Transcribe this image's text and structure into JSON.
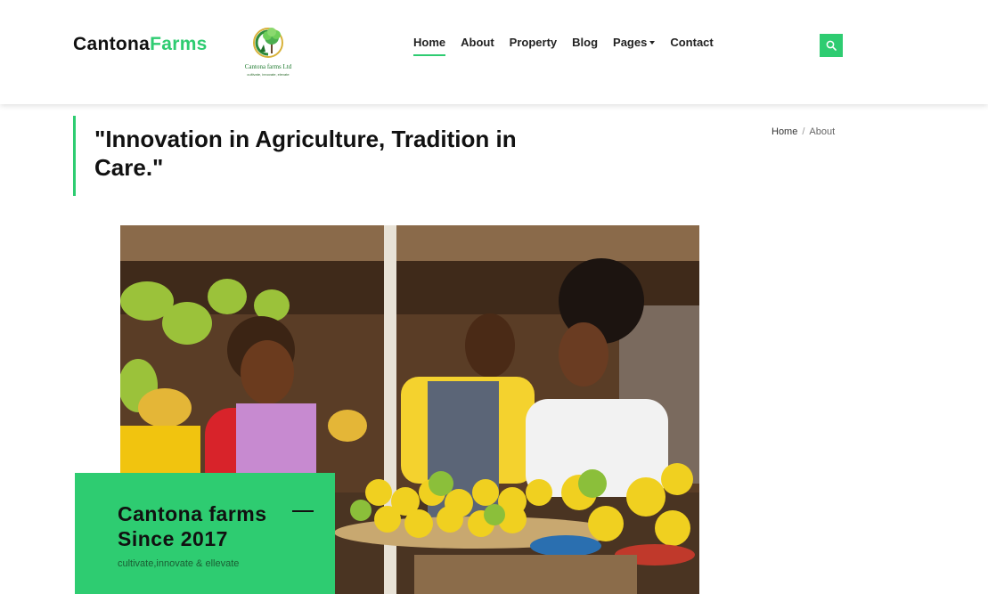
{
  "brand": {
    "name_part1": "Cantona",
    "name_part2": "Farms"
  },
  "logo": {
    "caption": "Cantona farms Ltd",
    "subcaption": "cultivate, innovate, elevate"
  },
  "nav": {
    "items": [
      {
        "label": "Home"
      },
      {
        "label": "About"
      },
      {
        "label": "Property"
      },
      {
        "label": "Blog"
      },
      {
        "label": "Pages"
      },
      {
        "label": "Contact"
      }
    ]
  },
  "quote": "\"Innovation in Agriculture, Tradition in Care.\"",
  "breadcrumb": {
    "home": "Home",
    "separator": "/",
    "current": "About"
  },
  "card": {
    "title": "Cantona farms Since 2017",
    "tagline": "cultivate,innovate & ellevate"
  },
  "colors": {
    "accent": "#2ecc71",
    "text": "#111111"
  },
  "icons": {
    "search": "search-icon",
    "logo": "tree-logo-icon"
  }
}
